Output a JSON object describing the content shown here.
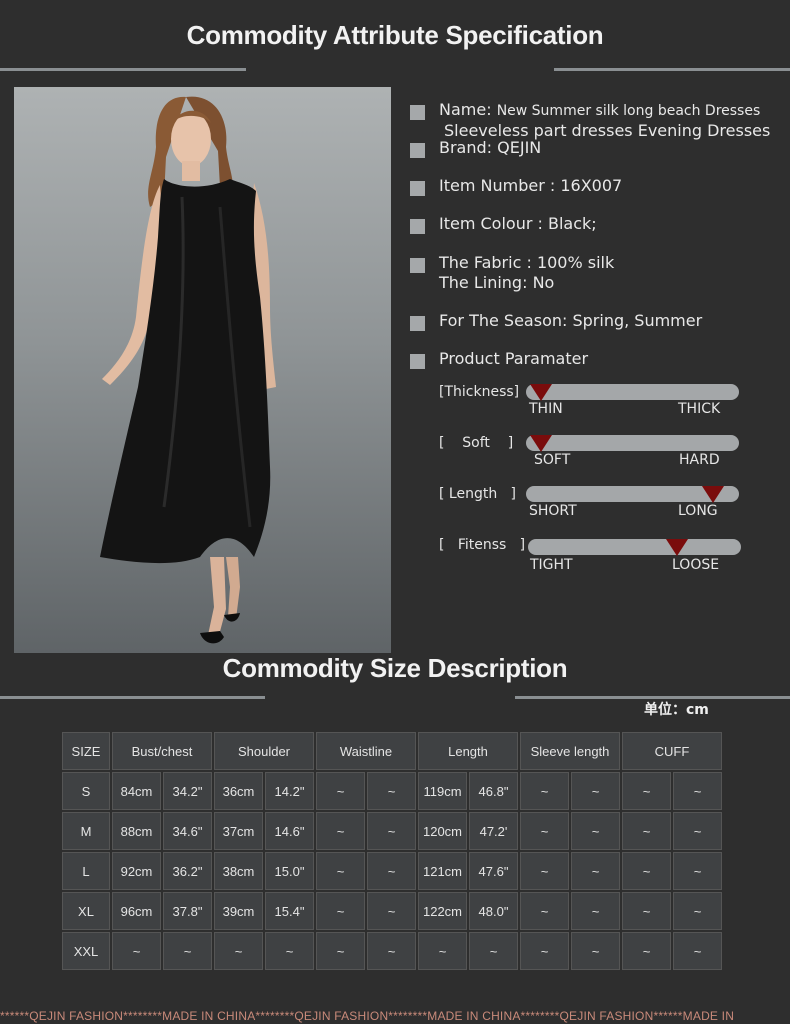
{
  "titles": {
    "attributes": "Commodity Attribute Specification",
    "sizes": "Commodity Size Description"
  },
  "attributes": [
    {
      "label": "Name:",
      "value": "New Summer silk long beach Dresses",
      "value2": "Sleeveless part dresses Evening Dresses"
    },
    {
      "label": "Brand:",
      "value": "QEJIN"
    },
    {
      "label": "Item Number :",
      "value": "16X007"
    },
    {
      "label": "Item Colour :",
      "value": "Black;"
    },
    {
      "label": "The Fabric :",
      "value": "100% silk",
      "label2": "The Lining:",
      "value2": "No"
    },
    {
      "label": "For The Season:",
      "value": "Spring, Summer"
    },
    {
      "label": "Product Paramater",
      "value": ""
    }
  ],
  "parameters": [
    {
      "label": "[Thickness]",
      "left": "THIN",
      "right": "THICK",
      "level": 0.07
    },
    {
      "label": "[    Soft    ]",
      "left": "SOFT",
      "right": "HARD",
      "level": 0.07
    },
    {
      "label": "[ Length   ]",
      "left": "SHORT",
      "right": "LONG",
      "level": 0.88
    },
    {
      "label": "[   Fitenss   ]",
      "left": "TIGHT",
      "right": "LOOSE",
      "level": 0.7
    }
  ],
  "unit_label": "单位：cm",
  "size_table": {
    "headers": [
      "SIZE",
      "Bust/chest",
      "Shoulder",
      "Waistline",
      "Length",
      "Sleeve length",
      "CUFF"
    ],
    "rows": [
      [
        "S",
        "84cm",
        "34.2\"",
        "36cm",
        "14.2\"",
        "~",
        "~",
        "119cm",
        "46.8\"",
        "~",
        "~",
        "~",
        "~"
      ],
      [
        "M",
        "88cm",
        "34.6\"",
        "37cm",
        "14.6\"",
        "~",
        "~",
        "120cm",
        "47.2'",
        "~",
        "~",
        "~",
        "~"
      ],
      [
        "L",
        "92cm",
        "36.2\"",
        "38cm",
        "15.0\"",
        "~",
        "~",
        "121cm",
        "47.6\"",
        "~",
        "~",
        "~",
        "~"
      ],
      [
        "XL",
        "96cm",
        "37.8\"",
        "39cm",
        "15.4\"",
        "~",
        "~",
        "122cm",
        "48.0\"",
        "~",
        "~",
        "~",
        "~"
      ],
      [
        "XXL",
        "~",
        "~",
        "~",
        "~",
        "~",
        "~",
        "~",
        "~",
        "~",
        "~",
        "~",
        "~"
      ]
    ]
  },
  "footer": "******QEJIN FASHION********MADE IN CHINA********QEJIN FASHION********MADE IN CHINA********QEJIN FASHION******MADE IN"
}
